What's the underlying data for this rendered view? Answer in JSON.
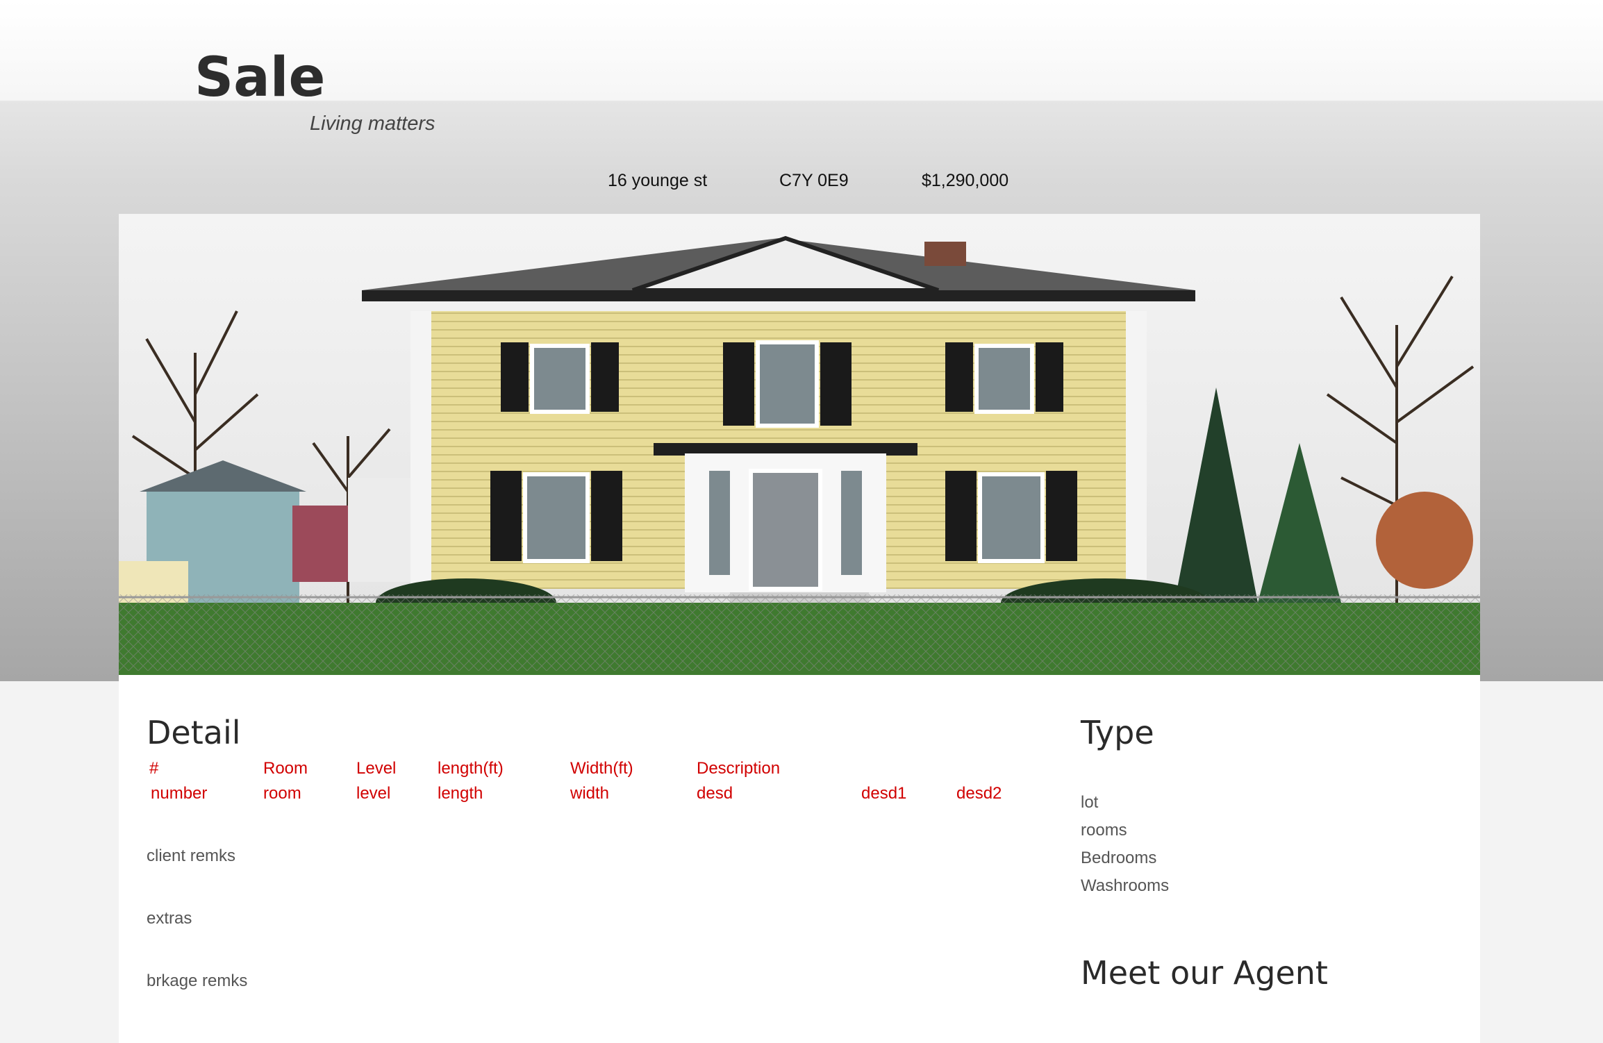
{
  "header": {
    "title": "Sale",
    "tagline": "Living matters"
  },
  "listing": {
    "address": "16 younge st",
    "postal_code": "C7Y 0E9",
    "price": "$1,290,000"
  },
  "hero": {
    "subject": "house-photo"
  },
  "detail": {
    "heading": "Detail",
    "columns": [
      "#",
      "Room",
      "Level",
      "length(ft)",
      "Width(ft)",
      "Description"
    ],
    "row": [
      "number",
      "room",
      "level",
      "length",
      "width",
      "desd",
      "desd1",
      "desd2"
    ],
    "remarks": [
      "client remks",
      "extras",
      "brkage remks"
    ]
  },
  "type": {
    "heading": "Type",
    "items": [
      "lot",
      "rooms",
      "Bedrooms",
      "Washrooms"
    ]
  },
  "agent": {
    "heading": "Meet our Agent"
  },
  "colors": {
    "table_text": "#d10000",
    "heading_text": "#2a2a2a",
    "body_text": "#555555",
    "content_bg": "#ffffff",
    "page_bg": "#f3f3f3"
  }
}
